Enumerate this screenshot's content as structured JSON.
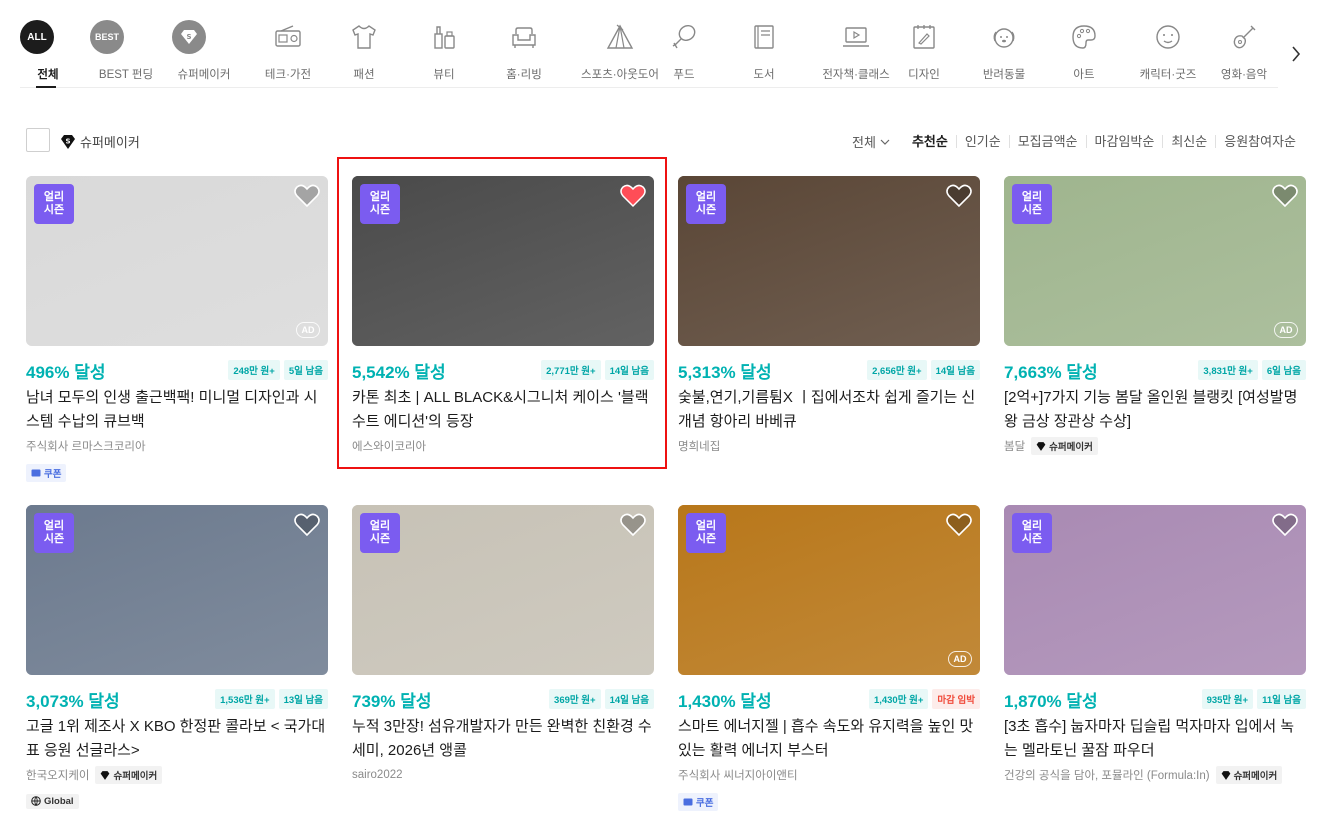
{
  "categories": [
    {
      "label": "전체",
      "icon": "all-icon",
      "circle": "ALL",
      "active": true
    },
    {
      "label": "BEST 펀딩",
      "icon": "best-icon",
      "circle": "BEST"
    },
    {
      "label": "슈퍼메이커",
      "icon": "super-maker-icon",
      "circle": "S"
    },
    {
      "label": "테크·가전",
      "icon": "radio-icon"
    },
    {
      "label": "패션",
      "icon": "tshirt-icon"
    },
    {
      "label": "뷰티",
      "icon": "cosmetics-icon"
    },
    {
      "label": "홈·리빙",
      "icon": "sofa-icon"
    },
    {
      "label": "스포츠·아웃도어",
      "icon": "tent-icon"
    },
    {
      "label": "푸드",
      "icon": "drumstick-icon"
    },
    {
      "label": "도서",
      "icon": "book-icon"
    },
    {
      "label": "전자책·클래스",
      "icon": "laptop-play-icon"
    },
    {
      "label": "디자인",
      "icon": "design-icon"
    },
    {
      "label": "반려동물",
      "icon": "dog-icon"
    },
    {
      "label": "아트",
      "icon": "palette-icon"
    },
    {
      "label": "캐릭터·굿즈",
      "icon": "smile-icon"
    },
    {
      "label": "영화·음악",
      "icon": "guitar-icon"
    }
  ],
  "filter": {
    "supermaker_label": "슈퍼메이커",
    "all_label": "전체",
    "sorts": [
      "추천순",
      "인기순",
      "모집금액순",
      "마감임박순",
      "최신순",
      "응원참여자순"
    ],
    "active_sort": "추천순"
  },
  "badge": {
    "line1": "얼리",
    "line2": "시즌"
  },
  "ad_label": "AD",
  "supermaker_tag": "슈퍼메이커",
  "cards": [
    {
      "pct": "496% 달성",
      "amount": "248만 원+",
      "days": "5일 남음",
      "title": "남녀 모두의 인생 출근백팩! 미니멀 디자인과 시스템 수납의 큐브백",
      "maker": "주식회사 르마스크코리아",
      "liked": false,
      "ad": true,
      "coupon": "쿠폰",
      "bg": "#d9d9d9"
    },
    {
      "pct": "5,542% 달성",
      "amount": "2,771만 원+",
      "days": "14일 남음",
      "title": "카톤 최초 | ALL BLACK&시그니처 케이스 '블랙 수트 에디션'의 등장",
      "maker": "에스와이코리아",
      "liked": true,
      "ad": false,
      "bg": "#4a4a4a"
    },
    {
      "pct": "5,313% 달성",
      "amount": "2,656만 원+",
      "days": "14일 남음",
      "title": "숯불,연기,기름튐X ㅣ집에서조차 쉽게 즐기는 신개념 항아리 바베큐",
      "maker": "명희네집",
      "liked": false,
      "ad": false,
      "bg": "#5a4636"
    },
    {
      "pct": "7,663% 달성",
      "amount": "3,831만 원+",
      "days": "6일 남음",
      "title": "[2억+]7가지 기능 봄달 올인원 블랭킷 [여성발명왕 금상 장관상 수상]",
      "maker": "봄달",
      "supermaker": true,
      "liked": false,
      "ad": true,
      "bg": "#9fb58e"
    },
    {
      "pct": "3,073% 달성",
      "amount": "1,536만 원+",
      "days": "13일 남음",
      "title": "고글 1위 제조사 X KBO 한정판 콜라보 < 국가대표 응원 선글라스>",
      "maker": "한국오지케이",
      "supermaker": true,
      "liked": false,
      "ad": false,
      "global": "Global",
      "bg": "#6c7a8e"
    },
    {
      "pct": "739% 달성",
      "amount": "369만 원+",
      "days": "14일 남음",
      "title": "누적 3만장! 섬유개발자가 만든 완벽한 친환경 수세미, 2026년 앵콜",
      "maker": "sairo2022",
      "liked": false,
      "ad": false,
      "bg": "#c7c2b6"
    },
    {
      "pct": "1,430% 달성",
      "amount": "1,430만 원+",
      "days": "마감 임박",
      "days_red": true,
      "title": "스마트 에너지젤 | 흡수 속도와 유지력을 높인 맛있는 활력 에너지 부스터",
      "maker": "주식회사 씨너지아이앤티",
      "liked": false,
      "ad": true,
      "coupon": "쿠폰",
      "bg": "#b8771a"
    },
    {
      "pct": "1,870% 달성",
      "amount": "935만 원+",
      "days": "11일 남음",
      "title": "[3초 흡수] 눕자마자 딥슬립 먹자마자 입에서 녹는 멜라토닌 꿀잠 파우더",
      "maker": "건강의 공식을 담아, 포뮬라인 (Formula:In)",
      "supermaker": true,
      "liked": false,
      "ad": false,
      "bg": "#a98ab3"
    }
  ]
}
